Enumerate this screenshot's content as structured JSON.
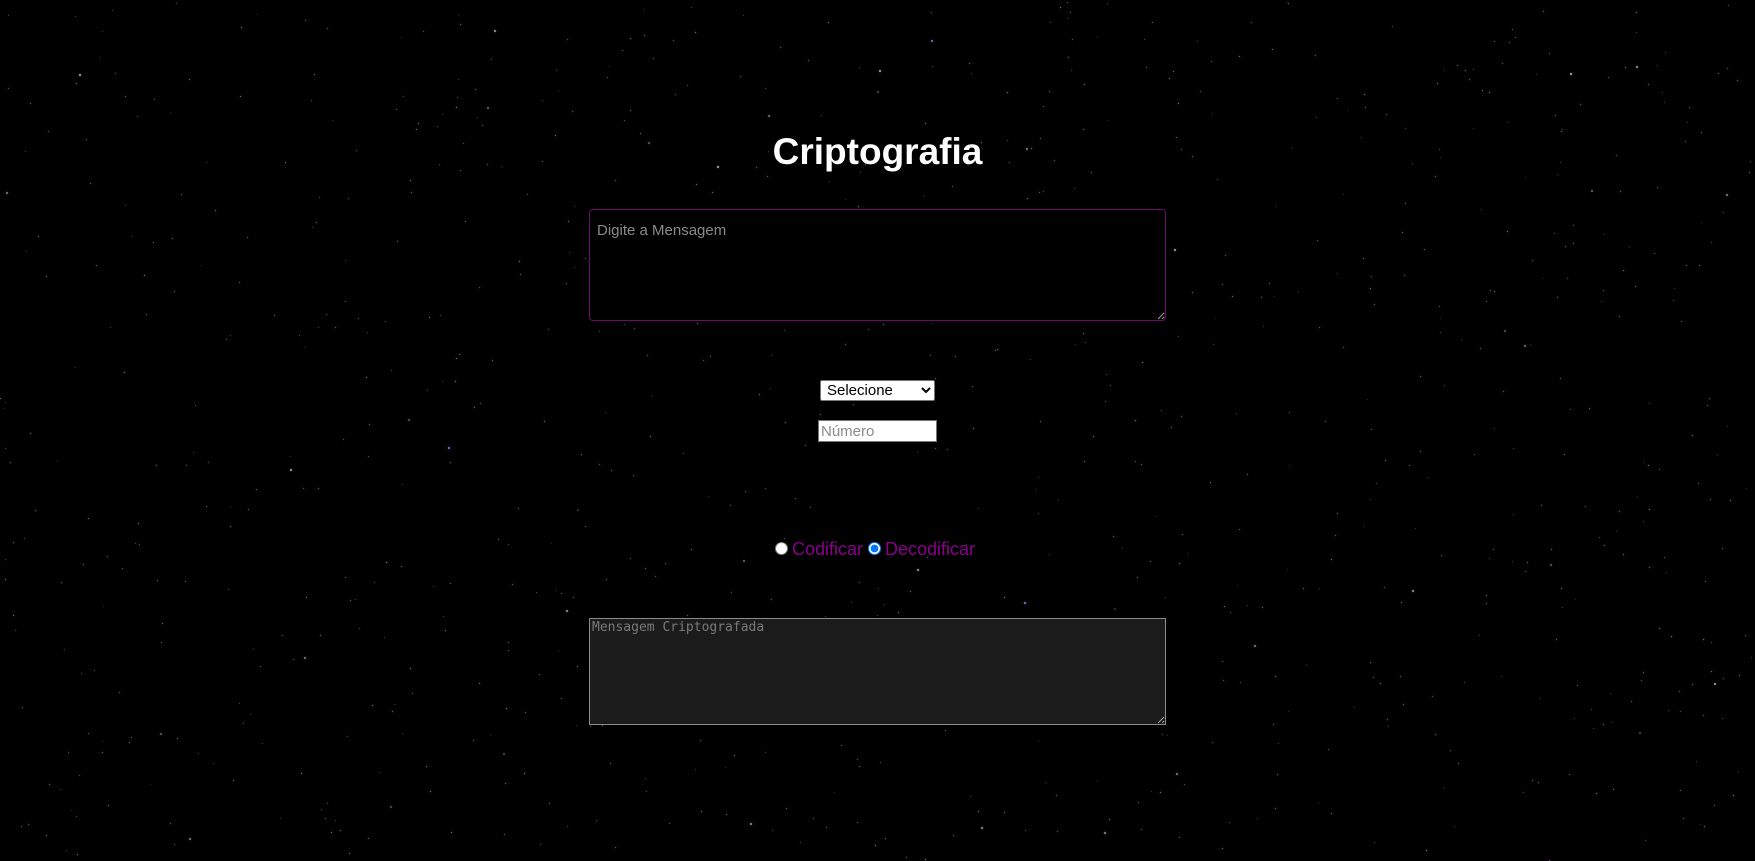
{
  "page": {
    "title": "Criptografia"
  },
  "message_input": {
    "placeholder": "Digite a Mensagem",
    "value": ""
  },
  "method_select": {
    "selected": "Selecione",
    "options": [
      "Selecione"
    ]
  },
  "number_input": {
    "placeholder": "Número",
    "value": ""
  },
  "mode": {
    "options": [
      {
        "label": "Codificar",
        "checked": false
      },
      {
        "label": "Decodificar",
        "checked": true
      }
    ]
  },
  "output": {
    "placeholder": "Mensagem Criptografada",
    "value": ""
  },
  "colors": {
    "background": "#000000",
    "accent": "#8b008b",
    "title": "#ffffff",
    "input_border": "#6e0b6e",
    "output_bg": "#1b1b1b"
  }
}
